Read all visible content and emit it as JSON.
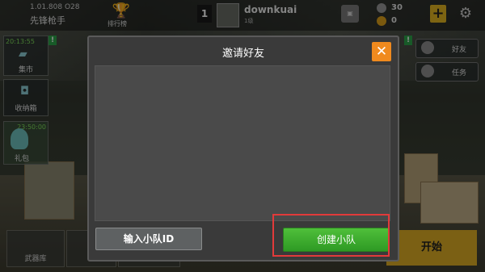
{
  "top_bar": {
    "version": "1.01.808 O28",
    "player_rank": "先锋枪手",
    "leaderboard_label": "排行榜",
    "level": "1",
    "username": "downkuai",
    "user_sub": "1级",
    "silver_count": "30",
    "gold_count": "0",
    "plus_label": "+",
    "settings_icon": "gear-icon"
  },
  "left_panel": {
    "timer1": "20:13:55",
    "tile1_label": "集市",
    "tile2_label": "收纳箱",
    "timer2": "23:50:00",
    "tile3_label": "礼包",
    "notice_mark": "!"
  },
  "right_panel": {
    "friends_label": "好友",
    "tasks_label": "任务",
    "notice_mark": "!"
  },
  "bottom_bar": {
    "armory_label": "武器库",
    "start_label": "开始"
  },
  "dialog": {
    "title": "邀请好友",
    "close_label": "✕",
    "team_id_button": "输入小队ID",
    "create_team_button": "创建小队"
  },
  "colors": {
    "accent_orange": "#f08a1e",
    "create_green": "#3fae2f",
    "highlight_red": "#e23a3a",
    "start_yellow": "#e0b025"
  }
}
